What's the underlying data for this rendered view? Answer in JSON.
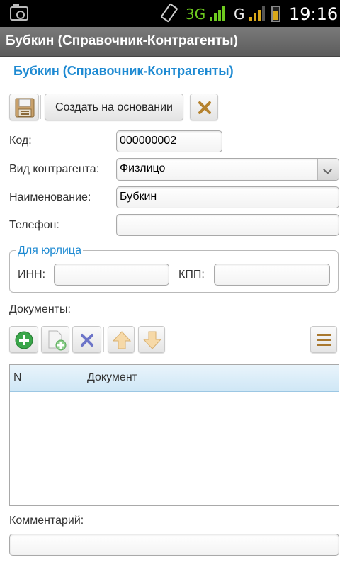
{
  "status_bar": {
    "network_3g": "3G",
    "network_g": "G",
    "time": "19:16",
    "icons": [
      "camera-icon",
      "vibrate-icon",
      "signal-icon",
      "battery-icon"
    ]
  },
  "window": {
    "title": "Бубкин (Справочник-Контрагенты)"
  },
  "form": {
    "title": "Бубкин (Справочник-Контрагенты)",
    "toolbar": {
      "save_icon": "floppy-disk-icon",
      "create_based_on_label": "Создать на основании",
      "close_icon": "close-icon"
    },
    "fields": {
      "code": {
        "label": "Код:",
        "value": "000000002"
      },
      "counterparty_type": {
        "label": "Вид контрагента:",
        "value": "Физлицо"
      },
      "name": {
        "label": "Наименование:",
        "value": "Бубкин"
      },
      "phone": {
        "label": "Телефон:",
        "value": ""
      }
    },
    "legal_group": {
      "legend": "Для юрлица",
      "inn": {
        "label": "ИНН:",
        "value": ""
      },
      "kpp": {
        "label": "КПП:",
        "value": ""
      }
    },
    "documents": {
      "label": "Документы:",
      "toolbar_icons": [
        "add-icon",
        "copy-icon",
        "delete-icon",
        "move-up-icon",
        "move-down-icon",
        "menu-icon"
      ],
      "columns": [
        "N",
        "Документ"
      ],
      "rows": []
    },
    "comment": {
      "label": "Комментарий:",
      "value": ""
    }
  },
  "colors": {
    "accent": "#1e8ad2",
    "title_bar": "#6a6a6a",
    "signal_3g": "#6ecb1f",
    "signal_g": "#d9a81a"
  }
}
